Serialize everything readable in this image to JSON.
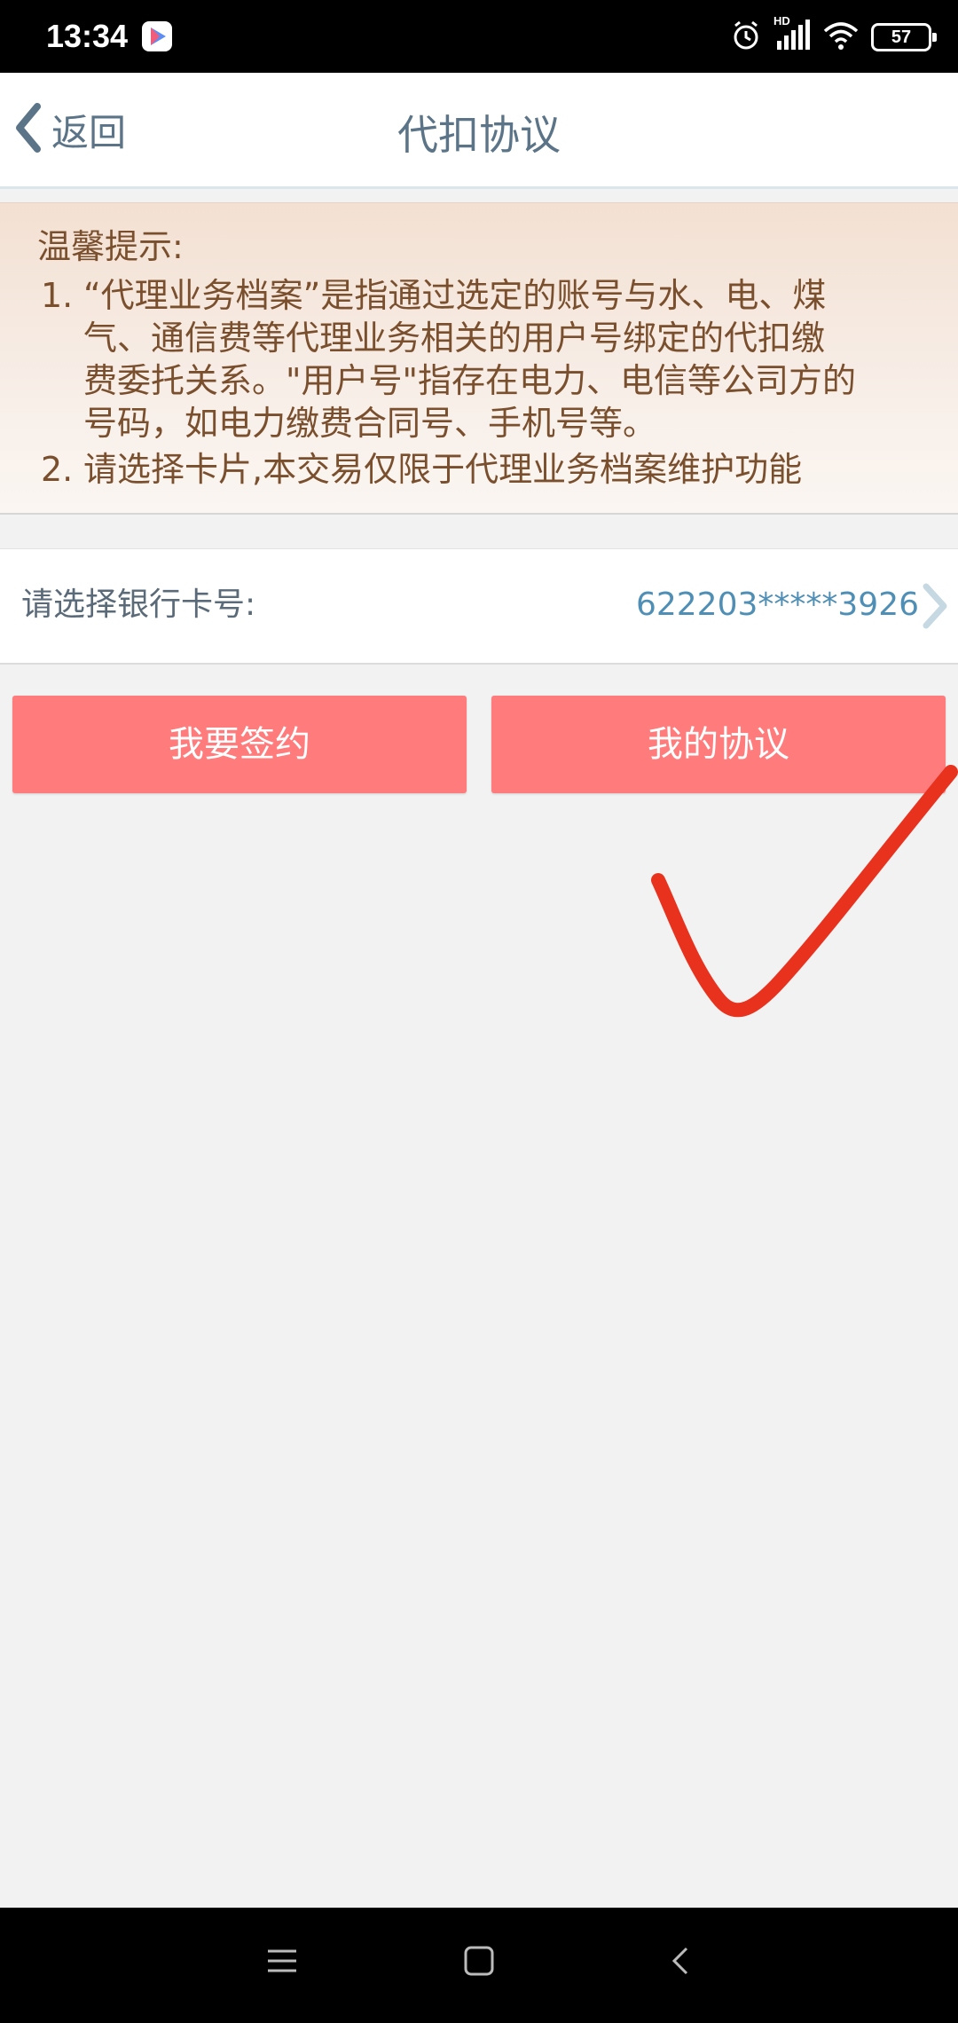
{
  "status_bar": {
    "time": "13:34",
    "battery": "57",
    "network_label": "HD",
    "icons": [
      "app-badge-icon",
      "alarm-icon",
      "signal-icon",
      "wifi-icon",
      "battery-icon"
    ]
  },
  "header": {
    "back_label": "返回",
    "title": "代扣协议"
  },
  "notice": {
    "title": "温馨提示:",
    "items": [
      {
        "number": "1.",
        "lines": [
          "“代理业务档案”是指通过选定的账号与水、电、煤",
          "气、通信费等代理业务相关的用户号绑定的代扣缴",
          "费委托关系。\"用户号\"指存在电力、电信等公司方的",
          "号码，如电力缴费合同号、手机号等。"
        ]
      },
      {
        "number": "2.",
        "lines": [
          "请选择卡片,本交易仅限于代理业务档案维护功能"
        ]
      }
    ]
  },
  "card_select": {
    "label": "请选择银行卡号:",
    "value": "622203*****3926"
  },
  "buttons": {
    "sign": "我要签约",
    "my_agreements": "我的协议"
  },
  "colors": {
    "button": "#ff7b7c",
    "accent_text": "#4f8fb5",
    "header_text": "#5b7487",
    "notice_text": "#7a4f2d",
    "annotation": "#e8321e"
  }
}
